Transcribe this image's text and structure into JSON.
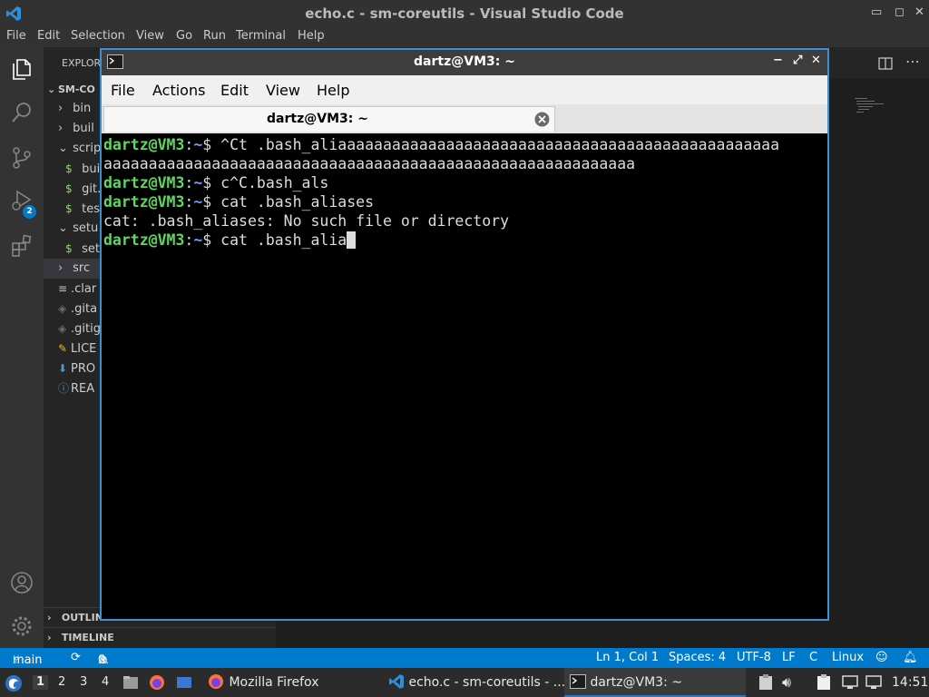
{
  "vscode": {
    "window_title": "echo.c - sm-coreutils - Visual Studio Code",
    "menu": [
      "File",
      "Edit",
      "Selection",
      "View",
      "Go",
      "Run",
      "Terminal",
      "Help"
    ],
    "source_control_badge": "2",
    "sidebar": {
      "header": "EXPLORER",
      "root": "SM-CO",
      "items": [
        {
          "label": "bin",
          "type": "folder-collapsed"
        },
        {
          "label": "buil",
          "type": "folder-collapsed"
        },
        {
          "label": "scrip",
          "type": "folder-expanded"
        },
        {
          "label": "buil",
          "type": "shell-file"
        },
        {
          "label": "git.",
          "type": "shell-file"
        },
        {
          "label": "tes",
          "type": "shell-file"
        },
        {
          "label": "setu",
          "type": "folder-expanded"
        },
        {
          "label": "set",
          "type": "shell-file"
        },
        {
          "label": "src",
          "type": "folder-collapsed"
        },
        {
          "label": ".clar",
          "type": "lines-file"
        },
        {
          "label": ".gita",
          "type": "git-file"
        },
        {
          "label": ".gitig",
          "type": "git-file"
        },
        {
          "label": "LICE",
          "type": "license-file"
        },
        {
          "label": "PRO",
          "type": "download-file"
        },
        {
          "label": "REA",
          "type": "info-file"
        }
      ],
      "outline": "OUTLINE",
      "timeline": "TIMELINE"
    },
    "status": {
      "branch": "main",
      "errors": "0",
      "warnings": "0",
      "position": "Ln 1, Col 1",
      "spaces": "Spaces: 4",
      "encoding": "UTF-8",
      "eol": "LF",
      "language": "C",
      "os": "Linux"
    }
  },
  "terminal": {
    "window_title": "dartz@VM3: ~",
    "menu": [
      "File",
      "Actions",
      "Edit",
      "View",
      "Help"
    ],
    "tab_label": "dartz@VM3: ~",
    "prompt_user": "dartz@VM3",
    "prompt_sep": ":",
    "prompt_path": "~",
    "prompt_dollar": "$",
    "lines": [
      {
        "type": "prompt",
        "cmd": " ^Ct .bash_aliaaaaaaaaaaaaaaaaaaaaaaaaaaaaaaaaaaaaaaaaaaaaaaaaa"
      },
      {
        "type": "output",
        "text": "aaaaaaaaaaaaaaaaaaaaaaaaaaaaaaaaaaaaaaaaaaaaaaaaaaaaaaaaaaa"
      },
      {
        "type": "prompt",
        "cmd": " c^C.bash_als"
      },
      {
        "type": "prompt",
        "cmd": " cat .bash_aliases"
      },
      {
        "type": "output",
        "text": "cat: .bash_aliases: No such file or directory"
      },
      {
        "type": "prompt",
        "cmd": " cat .bash_alia"
      }
    ]
  },
  "taskbar": {
    "workspaces": [
      "1",
      "2",
      "3",
      "4"
    ],
    "tasks": [
      {
        "label": "Mozilla Firefox",
        "icon": "firefox-icon"
      },
      {
        "label": "echo.c - sm-coreutils - ...",
        "icon": "vscode-icon"
      },
      {
        "label": "dartz@VM3: ~",
        "icon": "terminal-icon"
      }
    ],
    "clock": "14:51"
  }
}
